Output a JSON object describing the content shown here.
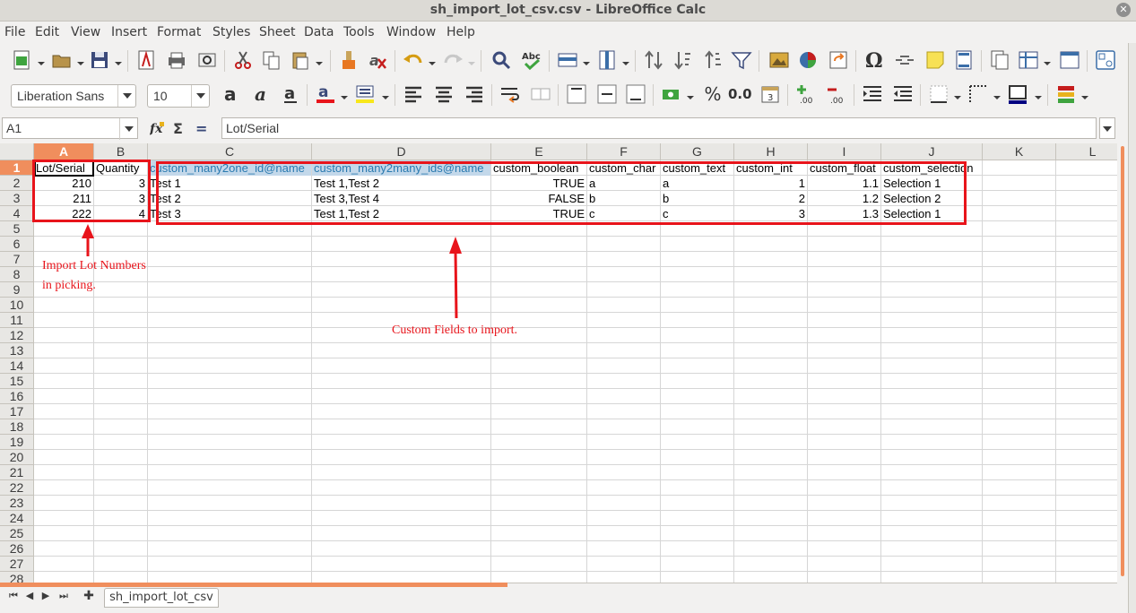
{
  "window": {
    "title": "sh_import_lot_csv.csv - LibreOffice Calc",
    "close_glyph": "✕"
  },
  "menu": [
    "File",
    "Edit",
    "View",
    "Insert",
    "Format",
    "Styles",
    "Sheet",
    "Data",
    "Tools",
    "Window",
    "Help"
  ],
  "format_toolbar": {
    "font_name": "Liberation Sans",
    "font_size": "10",
    "percent": "%",
    "number_format": "0.0"
  },
  "formula_bar": {
    "cell_ref": "A1",
    "content": "Lot/Serial",
    "sum_icon": "Σ",
    "equals_icon": "="
  },
  "columns": [
    "A",
    "B",
    "C",
    "D",
    "E",
    "F",
    "G",
    "H",
    "I",
    "J",
    "K",
    "L"
  ],
  "rows": [
    "1",
    "2",
    "3",
    "4",
    "5",
    "6",
    "7",
    "8",
    "9",
    "10",
    "11",
    "12",
    "13",
    "14",
    "15",
    "16",
    "17",
    "18",
    "19",
    "20",
    "21",
    "22",
    "23",
    "24",
    "25",
    "26",
    "27",
    "28"
  ],
  "sheet": {
    "header": [
      "Lot/Serial",
      "Quantity",
      "custom_many2one_id@name",
      "custom_many2many_ids@name",
      "custom_boolean",
      "custom_char",
      "custom_text",
      "custom_int",
      "custom_float",
      "custom_selection"
    ],
    "data": [
      [
        "210",
        "3",
        "Test 1",
        "Test 1,Test 2",
        "TRUE",
        "a",
        "a",
        "1",
        "1.1",
        "Selection 1"
      ],
      [
        "211",
        "3",
        "Test 2",
        "Test 3,Test 4",
        "FALSE",
        "b",
        "b",
        "2",
        "1.2",
        "Selection 2"
      ],
      [
        "222",
        "4",
        "Test 3",
        "Test 1,Test 2",
        "TRUE",
        "c",
        "c",
        "3",
        "1.3",
        "Selection 1"
      ]
    ]
  },
  "annotations": {
    "lot_note_line1": "Import Lot Numbers",
    "lot_note_line2": "in picking.",
    "custom_note": "Custom Fields to import."
  },
  "tabs": {
    "sheet_name": "sh_import_lot_csv",
    "add_glyph": "✚",
    "nav": [
      "⏮",
      "◀",
      "▶",
      "⏭"
    ]
  },
  "colors": {
    "accent": "#f08e5d",
    "annotation": "#e8141b",
    "highlight": "#c3d8ea"
  }
}
